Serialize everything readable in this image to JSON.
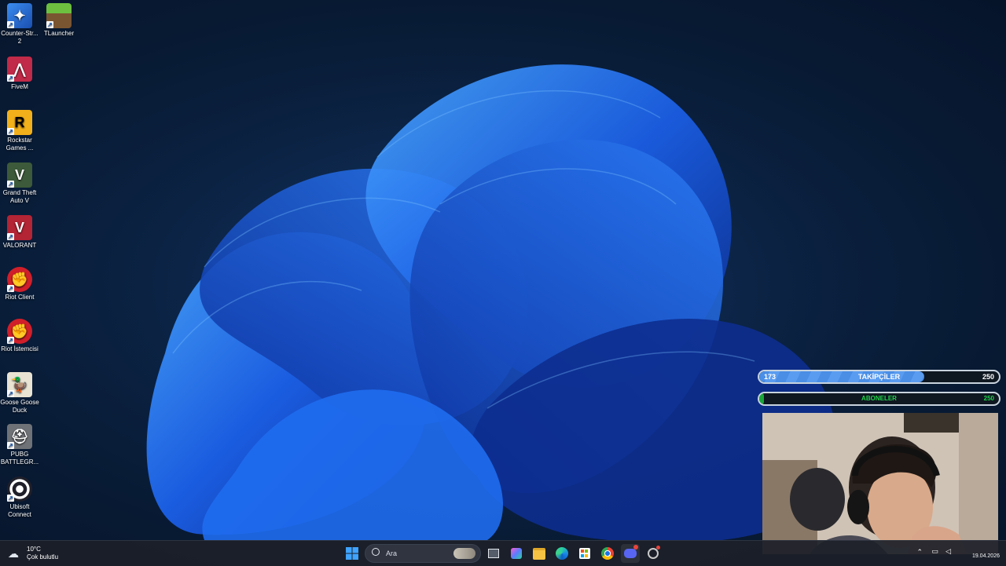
{
  "desktop": {
    "icons": [
      {
        "label": "Counter-Str... 2",
        "color": "#2a6fd6"
      },
      {
        "label": "TLauncher",
        "color": "#5aa83a"
      },
      {
        "label": "FiveM",
        "color": "#c12a48"
      },
      {
        "label": "Rockstar Games ...",
        "color": "#f2b01a"
      },
      {
        "label": "Grand Theft Auto V",
        "color": "#3d5a3a"
      },
      {
        "label": "VALORANT",
        "color": "#b32435"
      },
      {
        "label": "Riot Client",
        "color": "#d11f2a"
      },
      {
        "label": "Riot İstemcisi",
        "color": "#d11f2a"
      },
      {
        "label": "Goose Goose Duck",
        "color": "#e9e3d3"
      },
      {
        "label": "PUBG BATTLEGR...",
        "color": "#6f7277"
      },
      {
        "label": "Ubisoft Connect",
        "color": "#1f1f2a"
      }
    ]
  },
  "overlay": {
    "followers": {
      "current": "173",
      "label": "TAKİPÇİLER",
      "goal": "250",
      "progress": 0.69
    },
    "subscribers": {
      "current": "0",
      "label": "ABONELER",
      "goal": "250",
      "progress": 0.02
    }
  },
  "taskbar": {
    "weather": {
      "temp": "10°C",
      "desc": "Çok bulutlu"
    },
    "search_placeholder": "Ara",
    "date": "19.04.2026"
  }
}
